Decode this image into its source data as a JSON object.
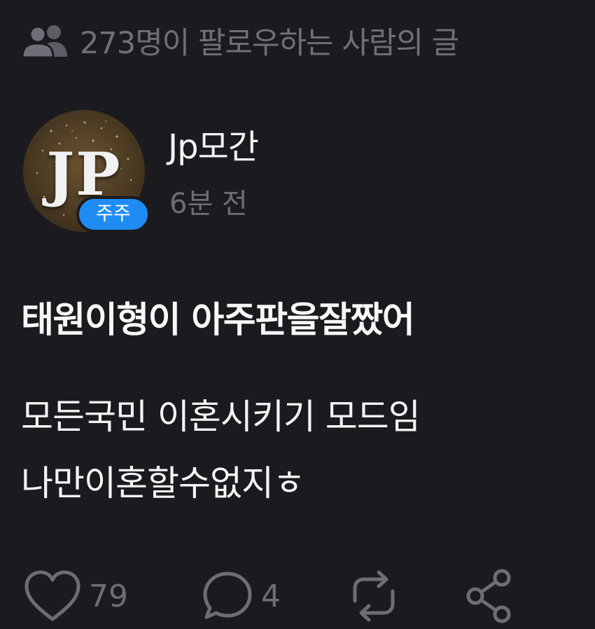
{
  "context": {
    "icon": "people-icon",
    "text": "273명이 팔로우하는 사람의 글"
  },
  "author": {
    "avatar_initials": "JP",
    "badge": "주주",
    "username": "Jp모간",
    "timestamp": "6분 전"
  },
  "post": {
    "title": "태원이형이 아주판을잘짰어",
    "lines": [
      "모든국민 이혼시키기 모드임",
      "나만이혼할수없지ㅎ"
    ]
  },
  "actions": {
    "like": {
      "icon": "heart-icon",
      "count": "79"
    },
    "comment": {
      "icon": "comment-icon",
      "count": "4"
    },
    "repost": {
      "icon": "repost-icon"
    },
    "share": {
      "icon": "share-icon"
    }
  },
  "colors": {
    "background": "#1b1b1f",
    "muted": "#6d6d76",
    "badge": "#1f8cf4",
    "text": "#f3f3f5"
  }
}
